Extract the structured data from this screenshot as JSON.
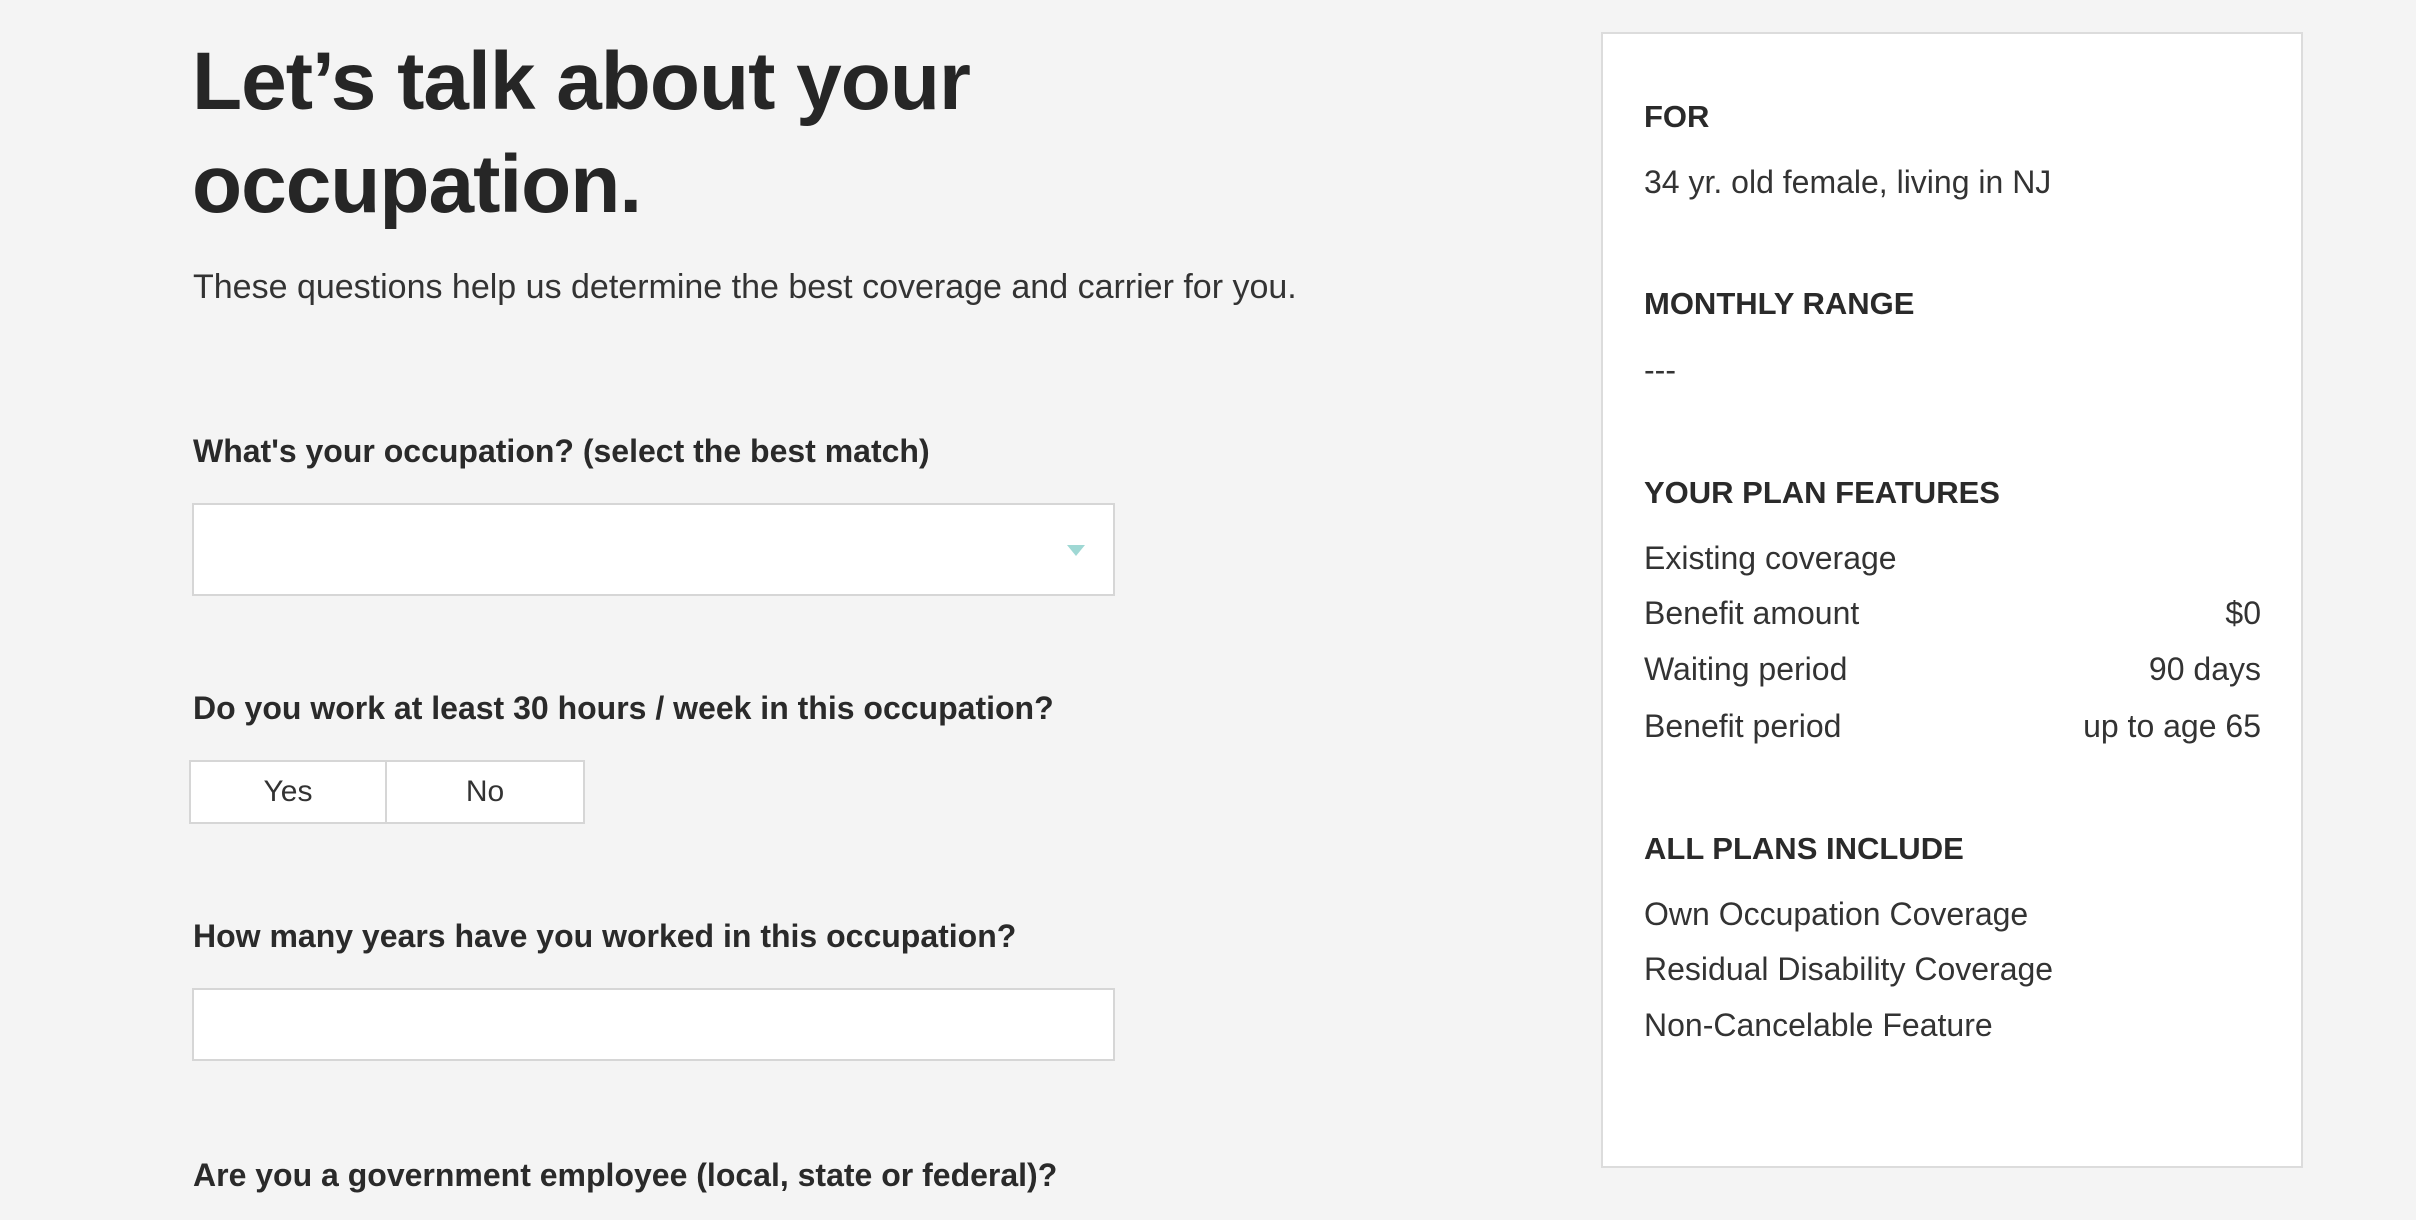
{
  "header": {
    "title": "Let’s talk about your occupation.",
    "subtitle": "These questions help us determine the best coverage and carrier for you."
  },
  "form": {
    "occupation": {
      "label": "What's your occupation? (select the best match)",
      "value": "",
      "icon": "caret-down-icon"
    },
    "hours": {
      "label": "Do you work at least 30 hours / week in this occupation?",
      "options": [
        "Yes",
        "No"
      ]
    },
    "years": {
      "label": "How many years have you worked in this occupation?",
      "value": ""
    },
    "government": {
      "label": "Are you a government employee (local, state or federal)?"
    }
  },
  "summary": {
    "for_heading": "FOR",
    "for_value": "34 yr. old female, living in NJ",
    "range_heading": "MONTHLY RANGE",
    "range_value": "---",
    "features_heading": "YOUR PLAN FEATURES",
    "features": [
      {
        "label": "Existing coverage",
        "value": ""
      },
      {
        "label": "Benefit amount",
        "value": "$0"
      },
      {
        "label": "Waiting period",
        "value": "90 days"
      },
      {
        "label": "Benefit period",
        "value": "up to age 65"
      }
    ],
    "includes_heading": "ALL PLANS INCLUDE",
    "includes": [
      "Own Occupation Coverage",
      "Residual Disability Coverage",
      "Non-Cancelable Feature"
    ]
  },
  "colors": {
    "background": "#f4f4f4",
    "accent": "#9fd8d4",
    "border": "#d6d6d6"
  }
}
